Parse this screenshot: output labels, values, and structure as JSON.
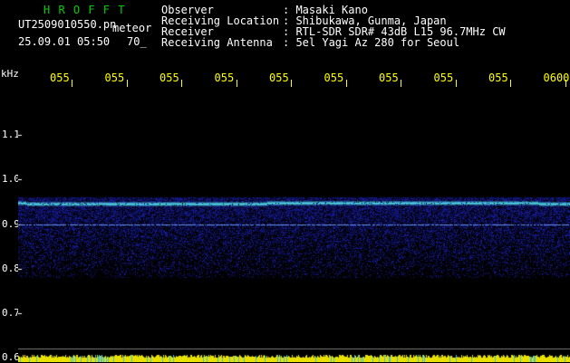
{
  "header": {
    "software": "H R O F F T",
    "filename": "UT2509010550.pn",
    "meteor_label": "meteor",
    "datetime": "25.09.01 05:50",
    "value": "70_",
    "fields": [
      {
        "label": "Observer",
        "value": ": Masaki Kano"
      },
      {
        "label": "Receiving Location",
        "value": ": Shibukawa, Gunma, Japan"
      },
      {
        "label": "Receiver",
        "value": ": RTL-SDR SDR# 43dB L15 96.7MHz CW"
      },
      {
        "label": "Receiving Antenna",
        "value": ": 5el Yagi Az 280 for Seoul"
      }
    ]
  },
  "chart_data": {
    "type": "heatmap",
    "ylabel": "kHz",
    "y_ticks": [
      "1.1",
      "1.0",
      "0.9",
      "0.8",
      "0.7",
      "0.6"
    ],
    "y_tick_values": [
      1.1,
      1.0,
      0.9,
      0.8,
      0.7,
      0.6
    ],
    "x_ticks": [
      "055",
      "055",
      "055",
      "055",
      "055",
      "055",
      "055",
      "055",
      "055",
      "0600"
    ],
    "ylim": [
      0.59,
      1.2
    ],
    "signal_lines_khz": [
      0.947,
      0.9
    ],
    "colors": {
      "background": "#000000",
      "noise": "#1a1f9a",
      "carrier": "#4fd8e8",
      "line2": "#6fa0ff",
      "ticks": "#ffff00",
      "bottom_bar": "#e8e000"
    }
  }
}
